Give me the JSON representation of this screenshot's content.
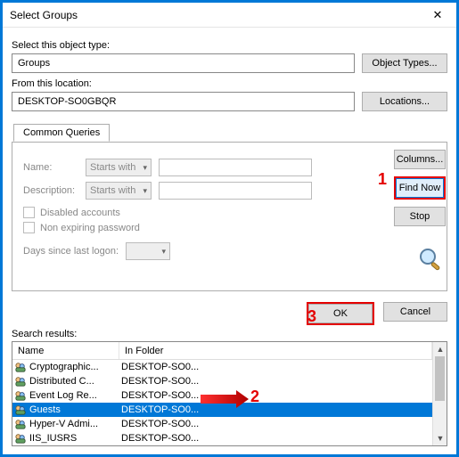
{
  "title": "Select Groups",
  "object_type_label": "Select this object type:",
  "object_type_value": "Groups",
  "object_types_btn": "Object Types...",
  "location_label": "From this location:",
  "location_value": "DESKTOP-SO0GBQR",
  "locations_btn": "Locations...",
  "tab_label": "Common Queries",
  "panel": {
    "name_label": "Name:",
    "name_mode": "Starts with",
    "desc_label": "Description:",
    "desc_mode": "Starts with",
    "disabled_label": "Disabled accounts",
    "nonexp_label": "Non expiring password",
    "days_label": "Days since last logon:"
  },
  "buttons": {
    "columns": "Columns...",
    "findnow": "Find Now",
    "stop": "Stop",
    "ok": "OK",
    "cancel": "Cancel"
  },
  "search_results_label": "Search results:",
  "columns": {
    "c1": "Name",
    "c2": "In Folder"
  },
  "rows": [
    {
      "name": "Cryptographic...",
      "folder": "DESKTOP-SO0...",
      "selected": false
    },
    {
      "name": "Distributed C...",
      "folder": "DESKTOP-SO0...",
      "selected": false
    },
    {
      "name": "Event Log Re...",
      "folder": "DESKTOP-SO0...",
      "selected": false
    },
    {
      "name": "Guests",
      "folder": "DESKTOP-SO0...",
      "selected": true
    },
    {
      "name": "Hyper-V Admi...",
      "folder": "DESKTOP-SO0...",
      "selected": false
    },
    {
      "name": "IIS_IUSRS",
      "folder": "DESKTOP-SO0...",
      "selected": false
    }
  ],
  "annotations": {
    "a1": "1",
    "a2": "2",
    "a3": "3"
  }
}
